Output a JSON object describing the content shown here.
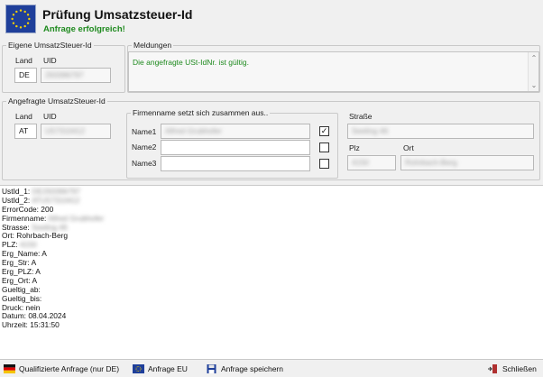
{
  "header": {
    "title": "Prüfung Umsatzsteuer-Id",
    "subtitle": "Anfrage erfolgreich!"
  },
  "own": {
    "legend": "Eigene UmsatzSteuer-Id",
    "land_label": "Land",
    "uid_label": "UID",
    "land": "DE",
    "uid": "293396797"
  },
  "messages": {
    "legend": "Meldungen",
    "text": "Die angefragte USt-IdNr. ist gültig."
  },
  "requested": {
    "legend": "Angefragte UmsatzSteuer-Id",
    "land_label": "Land",
    "uid_label": "UID",
    "land": "AT",
    "uid": "U57310412"
  },
  "company": {
    "legend": "Firmenname setzt sich zusammen aus..",
    "name1_label": "Name1",
    "name2_label": "Name2",
    "name3_label": "Name3",
    "name1": "Alfred Grubhofer",
    "name2": "",
    "name3": "",
    "name1_checked": true,
    "name2_checked": false,
    "name3_checked": false,
    "check_mark": "✓"
  },
  "address": {
    "street_label": "Straße",
    "street": "Seeling 46",
    "plz_label": "Plz",
    "ort_label": "Ort",
    "plz": "4150",
    "ort": "Rohrbach-Berg"
  },
  "output": [
    {
      "key": "UstId_1: ",
      "value": "DE293396797",
      "blur": true
    },
    {
      "key": "UstId_2: ",
      "value": "ATU57310412",
      "blur": true
    },
    {
      "key": "ErrorCode: ",
      "value": "200",
      "blur": false
    },
    {
      "key": "Firmenname: ",
      "value": "Alfred Grubhofer",
      "blur": true
    },
    {
      "key": "Strasse: ",
      "value": "Seeling 46",
      "blur": true
    },
    {
      "key": "Ort: ",
      "value": "Rohrbach-Berg",
      "blur": false
    },
    {
      "key": "PLZ: ",
      "value": "4150",
      "blur": true
    },
    {
      "key": "Erg_Name: ",
      "value": "A",
      "blur": false
    },
    {
      "key": "Erg_Str: ",
      "value": "A",
      "blur": false
    },
    {
      "key": "Erg_PLZ: ",
      "value": "A",
      "blur": false
    },
    {
      "key": "Erg_Ort: ",
      "value": "A",
      "blur": false
    },
    {
      "key": "Gueltig_ab:",
      "value": "",
      "blur": false
    },
    {
      "key": "Gueltig_bis:",
      "value": "",
      "blur": false
    },
    {
      "key": "Druck: ",
      "value": "nein",
      "blur": false
    },
    {
      "key": "Datum: ",
      "value": "08.04.2024",
      "blur": false
    },
    {
      "key": "Uhrzeit: ",
      "value": "15:31:50",
      "blur": false
    }
  ],
  "footer": {
    "qualified_label": "Qualifizierte Anfrage (nur DE)",
    "eu_label": "Anfrage EU",
    "save_label": "Anfrage speichern",
    "close_label": "Schließen"
  },
  "colors": {
    "success": "#1e8a1e",
    "eu_blue": "#1f3f9a",
    "eu_star": "#f5d000"
  },
  "icons": {
    "logo": "eu-flag-icon",
    "qualified": "germany-flag-icon",
    "eu": "eu-flag-icon",
    "save": "floppy-disk-icon",
    "close": "exit-door-icon"
  }
}
